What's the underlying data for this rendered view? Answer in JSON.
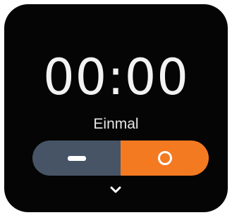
{
  "timer": {
    "time": "00:00",
    "mode": "Einmal"
  },
  "controls": {
    "left_icon": "minus-icon",
    "right_icon": "ring-icon",
    "left_color": "#465466",
    "right_color": "#f47a22"
  },
  "nav": {
    "more_icon": "chevron-down-icon"
  }
}
